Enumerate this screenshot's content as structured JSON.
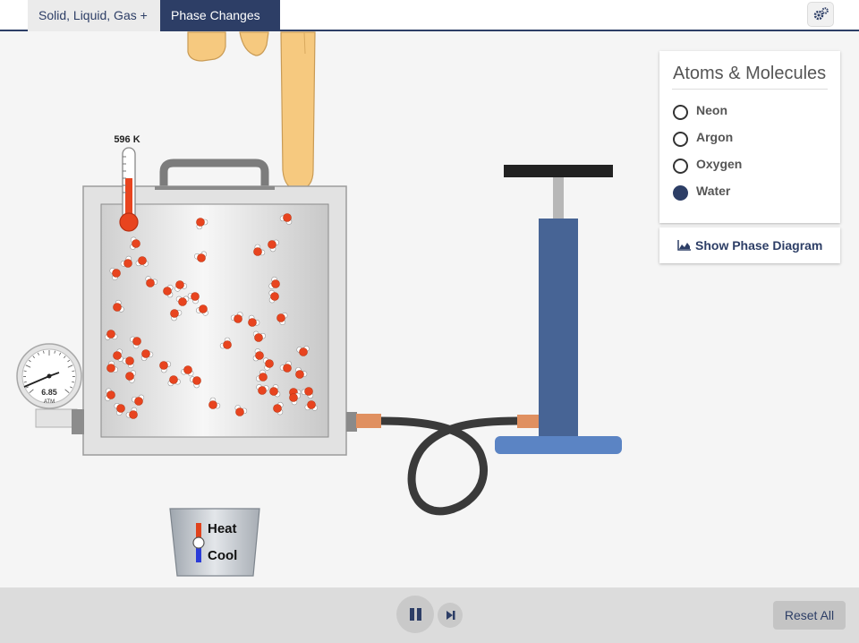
{
  "tabs": [
    {
      "label": "Solid, Liquid, Gas +",
      "active": false
    },
    {
      "label": "Phase Changes −",
      "active": true
    }
  ],
  "settings_icon": "gears-icon",
  "thermometer": {
    "label": "596 K"
  },
  "pressure_gauge": {
    "value": "6.85",
    "unit": "ATM"
  },
  "atoms_panel": {
    "title": "Atoms & Molecules",
    "options": [
      {
        "label": "Neon",
        "selected": false
      },
      {
        "label": "Argon",
        "selected": false
      },
      {
        "label": "Oxygen",
        "selected": false
      },
      {
        "label": "Water",
        "selected": true
      }
    ]
  },
  "phase_diagram_button": {
    "label": "Show Phase Diagram",
    "icon": "chart-area-icon"
  },
  "heat_cool": {
    "heat_label": "Heat",
    "cool_label": "Cool"
  },
  "controls": {
    "pause_icon": "pause-icon",
    "step_icon": "step-forward-icon",
    "reset_label": "Reset All"
  },
  "colors": {
    "accent": "#2d3e66",
    "pump": "#476495",
    "pump_base": "#5b84c4",
    "oxygen": "#e8441f",
    "thermometer_fluid": "#e8441f"
  }
}
